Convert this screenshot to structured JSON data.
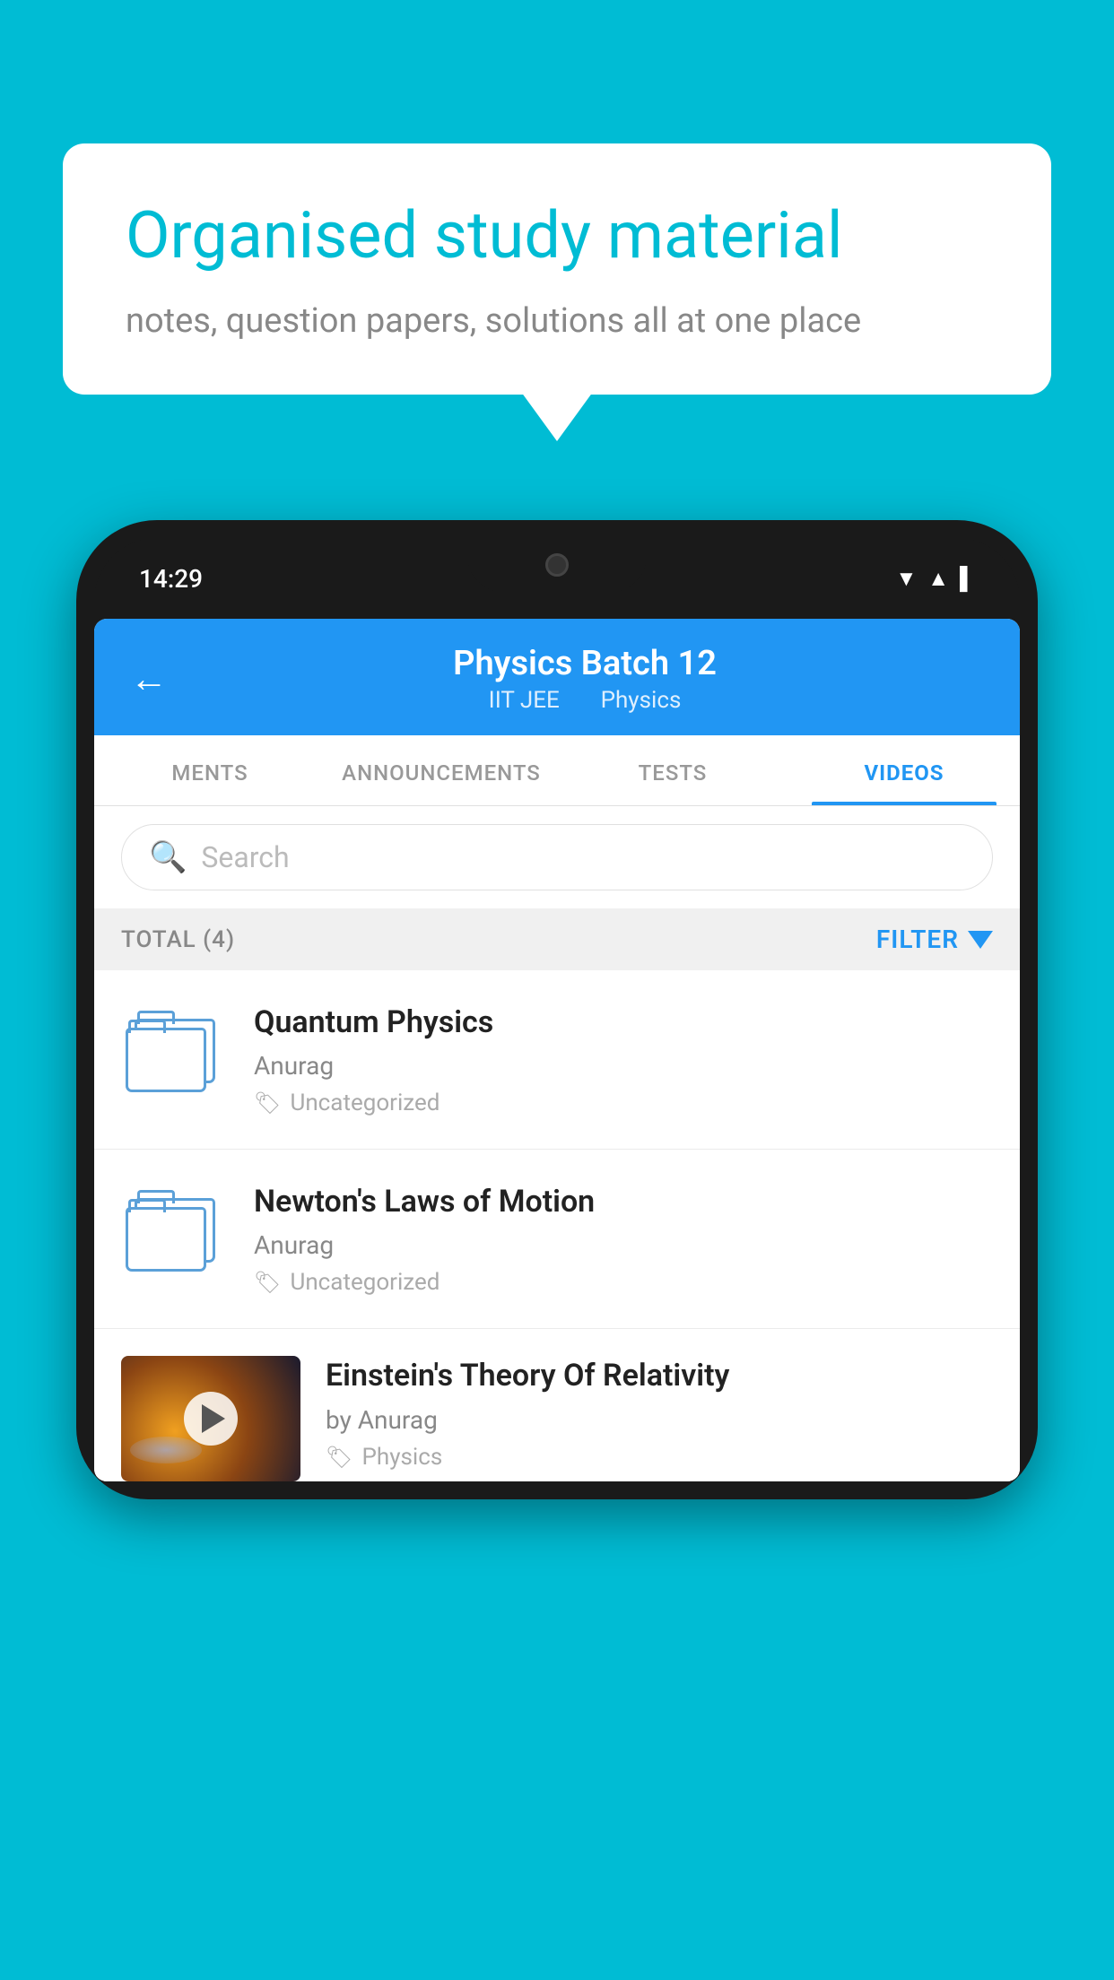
{
  "background_color": "#00BCD4",
  "bubble": {
    "title": "Organised study material",
    "subtitle": "notes, question papers, solutions all at one place"
  },
  "phone": {
    "time": "14:29",
    "header": {
      "title": "Physics Batch 12",
      "subtitle_part1": "IIT JEE",
      "subtitle_part2": "Physics",
      "back_label": "←"
    },
    "tabs": [
      {
        "label": "MENTS",
        "active": false
      },
      {
        "label": "ANNOUNCEMENTS",
        "active": false
      },
      {
        "label": "TESTS",
        "active": false
      },
      {
        "label": "VIDEOS",
        "active": true
      }
    ],
    "search": {
      "placeholder": "Search"
    },
    "filter_bar": {
      "total_label": "TOTAL (4)",
      "filter_label": "FILTER"
    },
    "videos": [
      {
        "id": 1,
        "title": "Quantum Physics",
        "author": "Anurag",
        "tag": "Uncategorized",
        "has_thumbnail": false
      },
      {
        "id": 2,
        "title": "Newton's Laws of Motion",
        "author": "Anurag",
        "tag": "Uncategorized",
        "has_thumbnail": false
      },
      {
        "id": 3,
        "title": "Einstein's Theory Of Relativity",
        "author": "by Anurag",
        "tag": "Physics",
        "has_thumbnail": true
      }
    ]
  }
}
